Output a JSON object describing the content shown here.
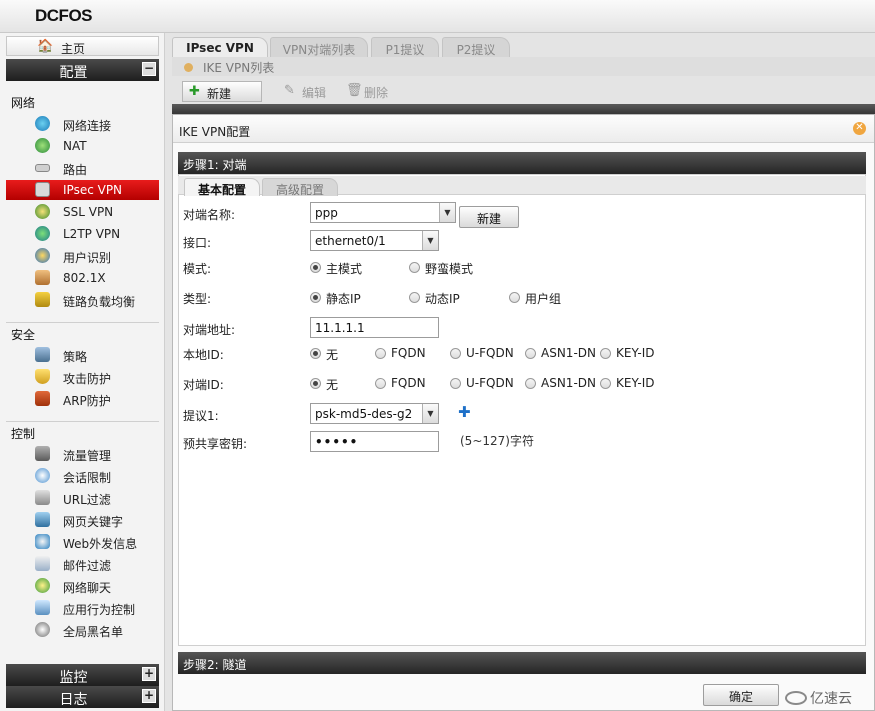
{
  "app": {
    "logo": "DCFOS"
  },
  "sidebar": {
    "home": "主页",
    "config_section": "配置",
    "config_toggle": "−",
    "groups": [
      {
        "title": "网络",
        "items": [
          "网络连接",
          "NAT",
          "路由",
          "IPsec VPN",
          "SSL VPN",
          "L2TP VPN",
          "用户识别",
          "802.1X",
          "链路负载均衡"
        ]
      },
      {
        "title": "安全",
        "items": [
          "策略",
          "攻击防护",
          "ARP防护"
        ]
      },
      {
        "title": "控制",
        "items": [
          "流量管理",
          "会话限制",
          "URL过滤",
          "网页关键字",
          "Web外发信息",
          "邮件过滤",
          "网络聊天",
          "应用行为控制",
          "全局黑名单"
        ]
      }
    ],
    "active_item": "IPsec VPN",
    "monitor_section": "监控",
    "log_section": "日志",
    "expand_toggle": "+"
  },
  "tabs": [
    "IPsec VPN",
    "VPN对端列表",
    "P1提议",
    "P2提议"
  ],
  "subbar": {
    "title": "IKE VPN列表"
  },
  "toolbar": {
    "new": "新建",
    "edit": "编辑",
    "delete": "删除"
  },
  "dialog": {
    "title": "IKE VPN配置",
    "step1": "步骤1: 对端",
    "step2": "步骤2: 隧道",
    "inner_tabs": [
      "基本配置",
      "高级配置"
    ],
    "fields": {
      "peer_name": {
        "label": "对端名称:",
        "value": "ppp",
        "button": "新建"
      },
      "interface": {
        "label": "接口:",
        "value": "ethernet0/1"
      },
      "mode": {
        "label": "模式:",
        "options": [
          "主模式",
          "野蛮模式"
        ],
        "selected": 0
      },
      "type": {
        "label": "类型:",
        "options": [
          "静态IP",
          "动态IP",
          "用户组"
        ],
        "selected": 0
      },
      "peer_addr": {
        "label": "对端地址:",
        "value": "11.1.1.1"
      },
      "local_id": {
        "label": "本地ID:",
        "options": [
          "无",
          "FQDN",
          "U-FQDN",
          "ASN1-DN",
          "KEY-ID"
        ],
        "selected": 0
      },
      "peer_id": {
        "label": "对端ID:",
        "options": [
          "无",
          "FQDN",
          "U-FQDN",
          "ASN1-DN",
          "KEY-ID"
        ],
        "selected": 0
      },
      "proposal": {
        "label": "提议1:",
        "value": "psk-md5-des-g2"
      },
      "psk": {
        "label": "预共享密钥:",
        "value": "•••••",
        "hint": "(5~127)字符"
      }
    },
    "ok": "确定"
  },
  "watermark": "亿速云"
}
